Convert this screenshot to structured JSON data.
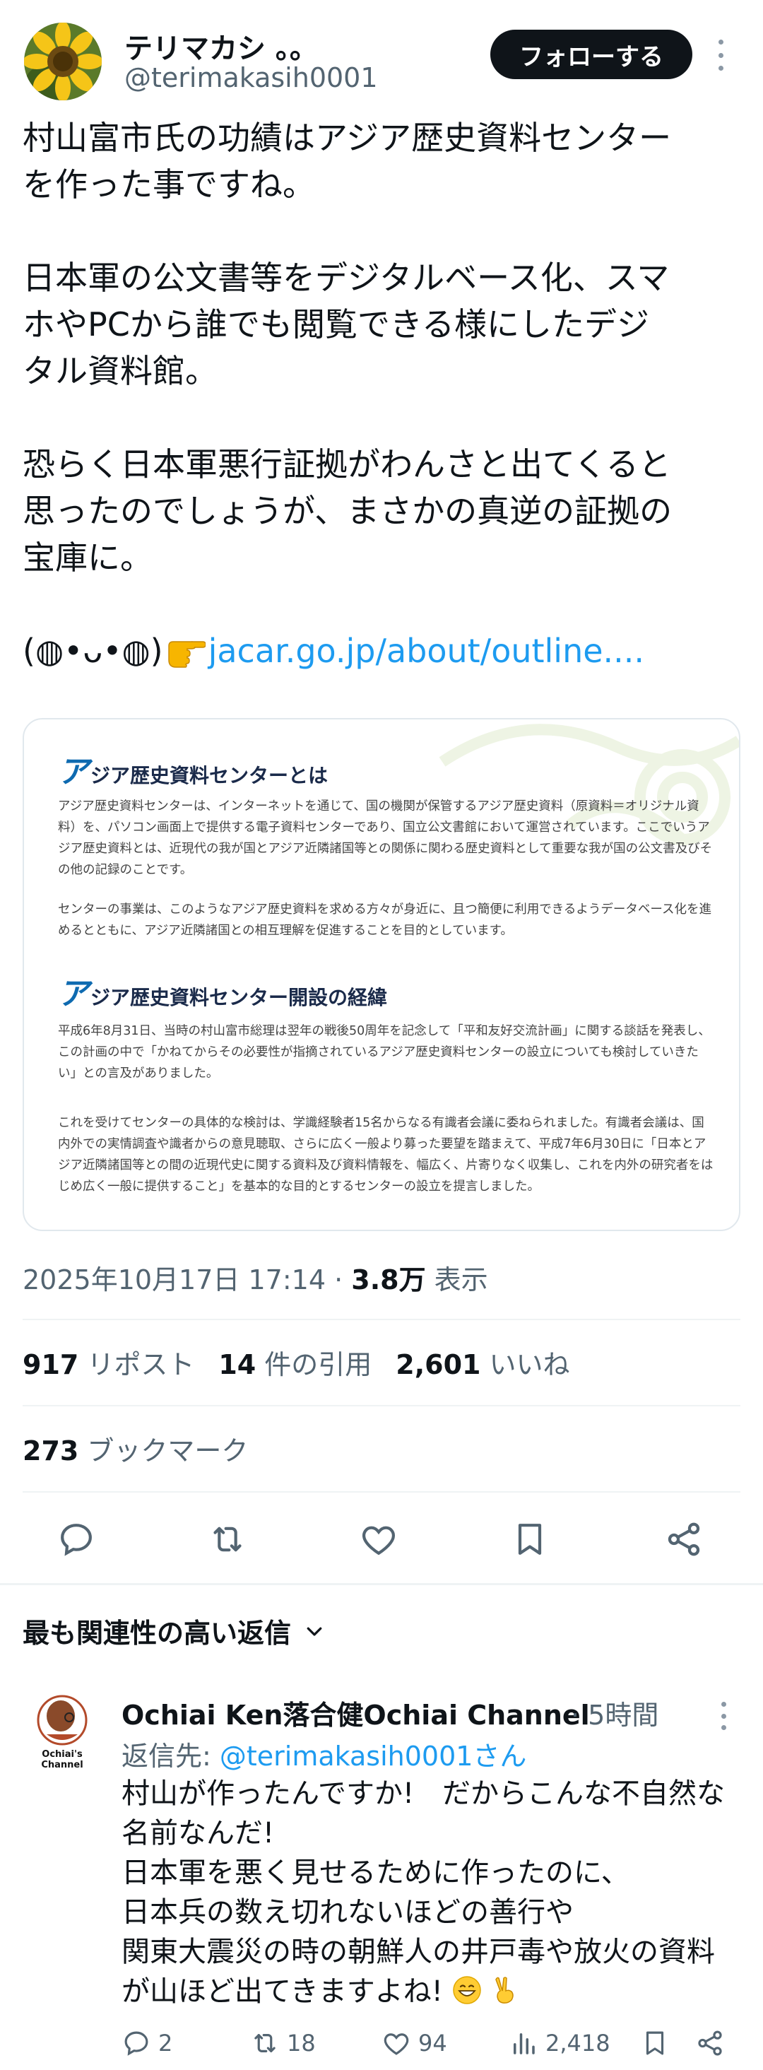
{
  "author": {
    "name": "テリマカシ 。。",
    "handle": "@terimakasih0001",
    "follow_label": "フォローする",
    "avatar_icon": "sunflower-avatar"
  },
  "tweet": {
    "paragraphs": [
      "村山富市氏の功績はアジア歴史資料センター\nを作った事ですね。",
      "日本軍の公文書等をデジタルベース化、スマ\nホやPCから誰でも閲覧できる様にしたデジ\nタル資料館。",
      "恐らく日本軍悪行証拠がわんさと出てくると\n思ったのでしょうが、まさかの真逆の証拠の\n宝庫に。"
    ],
    "kaomoji": "(◍•ᴗ•◍)",
    "link_text": "jacar.go.jp/about/outline....",
    "emoji_icon": "pointing-hand-icon"
  },
  "card": {
    "section1_title_initial": "ア",
    "section1_title_rest": "ジア歴史資料センターとは",
    "section1_p1": "アジア歴史資料センターは、インターネットを通じて、国の機関が保管するアジア歴史資料（原資料＝オリジナル資料）を、パソコン画面上で提供する電子資料センターであり、国立公文書館において運営されています。ここでいうアジア歴史資料とは、近現代の我が国とアジア近隣諸国等との関係に関わる歴史資料として重要な我が国の公文書及びその他の記録のことです。",
    "section1_p2": "センターの事業は、このようなアジア歴史資料を求める方々が身近に、且つ簡便に利用できるようデータベース化を進めるとともに、アジア近隣諸国との相互理解を促進することを目的としています。",
    "section2_title_initial": "ア",
    "section2_title_rest": "ジア歴史資料センター開設の経緯",
    "section2_p1": "平成6年8月31日、当時の村山富市総理は翌年の戦後50周年を記念して「平和友好交流計画」に関する談話を発表し、この計画の中で「かねてからその必要性が指摘されているアジア歴史資料センターの設立についても検討していきたい」との言及がありました。",
    "section2_p2": "これを受けてセンターの具体的な検討は、学識経験者15名からなる有識者会議に委ねられました。有識者会議は、国内外での実情調査や識者からの意見聴取、さらに広く一般より募った要望を踏まえて、平成7年6月30日に「日本とアジア近隣諸国等との間の近現代史に関する資料及び資料情報を、幅広く、片寄りなく収集し、これを内外の研究者をはじめ広く一般に提供すること」を基本的な目的とするセンターの設立を提言しました。"
  },
  "meta": {
    "timestamp": "2025年10月17日 17:14 · ",
    "views_count": "3.8万",
    "views_label": " 表示"
  },
  "stats": {
    "reposts_count": "917",
    "reposts_label": "リポスト",
    "quotes_count": "14",
    "quotes_label": "件の引用",
    "likes_count": "2,601",
    "likes_label": "いいね",
    "bookmarks_count": "273",
    "bookmarks_label": "ブックマーク"
  },
  "actions": [
    "reply-icon",
    "repost-icon",
    "like-icon",
    "bookmark-icon",
    "share-icon"
  ],
  "replies": {
    "heading": "最も関連性の高い返信",
    "reply": {
      "name": "Ochiai Ken落合健Ochiai Channel",
      "time": "· 5時間",
      "reply_to_label": "返信先: ",
      "reply_to_handle": "@terimakasih0001さん",
      "avatar_text": "Ochiai's\nChannel",
      "lines": [
        "村山が作ったんですか!　だからこんな不自然な",
        "名前なんだ!",
        "日本軍を悪く見せるために作ったのに、",
        "日本兵の数え切れないほどの善行や",
        "関東大震災の時の朝鮮人の井戸毒や放火の資料",
        "が山ほど出てきますよね!"
      ],
      "counts": {
        "replies": "2",
        "reposts": "18",
        "likes": "94",
        "views": "2,418"
      }
    }
  },
  "colors": {
    "link": "#1d9bf0",
    "secondary_text": "#536471",
    "primary_text": "#0f1419",
    "follow_bg": "#0f1419"
  }
}
